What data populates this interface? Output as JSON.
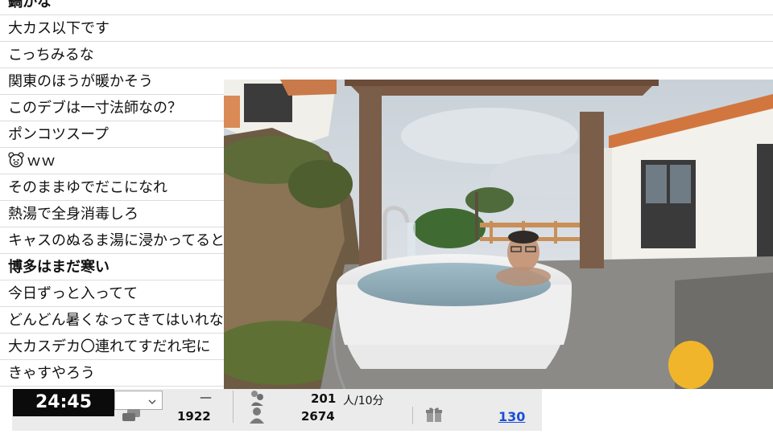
{
  "comments": [
    {
      "text": "鍋かな",
      "bold": true
    },
    {
      "text": "大カス以下です",
      "bold": false
    },
    {
      "text": "こっちみるな",
      "bold": false
    },
    {
      "text": "関東のほうが暖かそう",
      "bold": false
    },
    {
      "text": "このデブは一寸法師なの？",
      "bold": false
    },
    {
      "text": "ポンコツスープ",
      "bold": false
    },
    {
      "text": "ｗｗ",
      "bold": false,
      "icon": "bear-face-icon"
    },
    {
      "text": "そのままゆでだこになれ",
      "bold": false
    },
    {
      "text": "熱湯で全身消毒しろ",
      "bold": false
    },
    {
      "text": "キャスのぬるま湯に浸かってるとい",
      "bold": false
    },
    {
      "text": "博多はまだ寒い",
      "bold": true
    },
    {
      "text": "今日ずっと入ってて",
      "bold": false
    },
    {
      "text": "どんどん暑くなってきてはいれなくな",
      "bold": false
    },
    {
      "text": "大カスデカ〇連れてすだれ宅に",
      "bold": false
    },
    {
      "text": "きゃすやろう",
      "bold": false
    }
  ],
  "bar": {
    "timer": "24:45",
    "dash": "—",
    "comment_count": "1922",
    "viewers_per_10min": "201",
    "viewers_unit": "人/10分",
    "total_viewers": "2674",
    "gift_count": "130"
  },
  "icons": {
    "comment": "speech-bubble-icon",
    "viewers_group": "people-icon",
    "viewer_single": "person-icon",
    "gift": "gift-box-icon",
    "dropdown": "chevron-down-icon"
  },
  "colors": {
    "timer_bg": "#0b0b0b",
    "bar_bg": "#ebebeb",
    "link": "#1a4fd6"
  }
}
